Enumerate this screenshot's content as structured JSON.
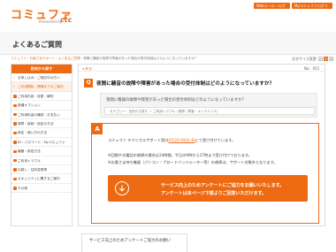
{
  "header": {
    "logo": "コミュファ",
    "logo_sub": "Presented by",
    "logo_ctc": "ctc",
    "btn_web_login": "Webメール・ログイン",
    "btn_my_login": "Myコミュファログイン"
  },
  "page": {
    "title": "よくあるご質問"
  },
  "breadcrumb": {
    "items": [
      "コミュファ",
      "お客さまサポート",
      "よくあるご質問"
    ],
    "current": "夜間に騒音の故障や障害があった場合の受付体制はどのようになっていますか？"
  },
  "font_size": {
    "label": "文字サイズ変更",
    "small": "小",
    "medium": "中",
    "large": "大"
  },
  "sidebar": {
    "heading": "目的から探す",
    "items": [
      {
        "label": "お申し込み・ご検討中の方へ"
      },
      {
        "label": "ご利用開始・開通までのご案内"
      },
      {
        "label": "ご利用内容・変更・解約"
      },
      {
        "label": "各種オプション"
      },
      {
        "label": "ご利用料金の確認・お支払い"
      },
      {
        "label": "故障・接続・設定の方法"
      },
      {
        "label": "設定・使い方の方法"
      },
      {
        "label": "ID・パスワード・Myコミュファ"
      },
      {
        "label": "機器・設定方法"
      },
      {
        "label": "ご利用トラブル"
      },
      {
        "label": "引越し・住所変更等"
      },
      {
        "label": "セキュリティに関するご案内"
      },
      {
        "label": "その他"
      }
    ]
  },
  "main": {
    "back": "戻る",
    "qno": "No：455",
    "q_badge": "Q",
    "q_title": "夜間に騒音の故障や障害があった場合の受付体制はどのようになっていますか？",
    "q_text": "夜間に機器の故障や障害があった場合の受付体制はどのようになっていますか？",
    "category": "カテゴリー：目的から探す ＞ ご利用トラブル（故障・障害・メンテナンス）",
    "a_badge": "A",
    "a_line1_prefix": "コミュファ テクニカルサポート窓口",
    "a_line1_link": "(0120-9441-8)",
    "a_line1_suffix": "にて受け付けています。",
    "a_line2": "※回線や光電話の故障の場合は24時間、平日の9時から17時まで受け付けております。",
    "a_line3": "※お客さま持ち機器（パソコン・ブロードバンドルーター等）の故障は、サポート対象外となります。",
    "survey_line1": "サービス向上のためアンケートにご協力をお願いいたします。",
    "survey_line2": "アンケートは本ページ下部よりご回答いただけます。"
  },
  "bottom": {
    "text": "サービス向上のためアンケートご協力のお願い"
  },
  "colors": {
    "accent": "#ee6a12",
    "panel_bg": "#f4f4f4",
    "border": "#dddddd"
  }
}
